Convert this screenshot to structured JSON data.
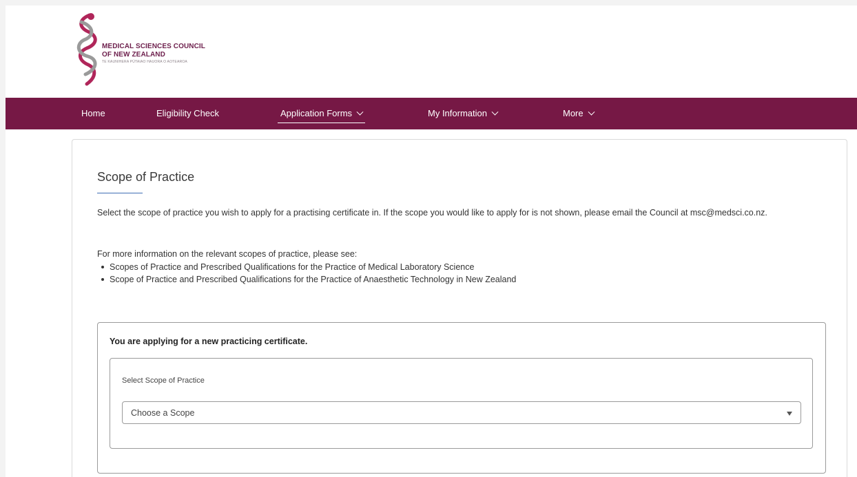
{
  "org": {
    "name_line1": "MEDICAL SCIENCES COUNCIL",
    "name_line2": "OF NEW ZEALAND",
    "maori_name": "TE KAUNIHERA PŪTAIAO HAUORA O AOTEAROA",
    "brand_color": "#761845"
  },
  "nav": {
    "items": [
      {
        "label": "Home"
      },
      {
        "label": "Eligibility Check"
      },
      {
        "label": "Application Forms",
        "active": true
      },
      {
        "label": "My Information"
      },
      {
        "label": "More"
      }
    ]
  },
  "main": {
    "title": "Scope of Practice",
    "description": "Select the scope of practice you wish to apply for a practising certificate in. If the scope you would like to apply for is not shown, please email the Council at msc@medsci.co.nz.",
    "more_info": "For more information on the relevant scopes of practice, please see:",
    "links": [
      "Scopes of Practice and Prescribed Qualifications for the Practice of Medical Laboratory Science",
      "Scope of Practice and Prescribed Qualifications for the Practice of Anaesthetic Technology in New Zealand"
    ],
    "application_heading": "You are applying for a new practicing certificate.",
    "scope_label": "Select Scope of Practice",
    "scope_value": "Choose a Scope"
  }
}
